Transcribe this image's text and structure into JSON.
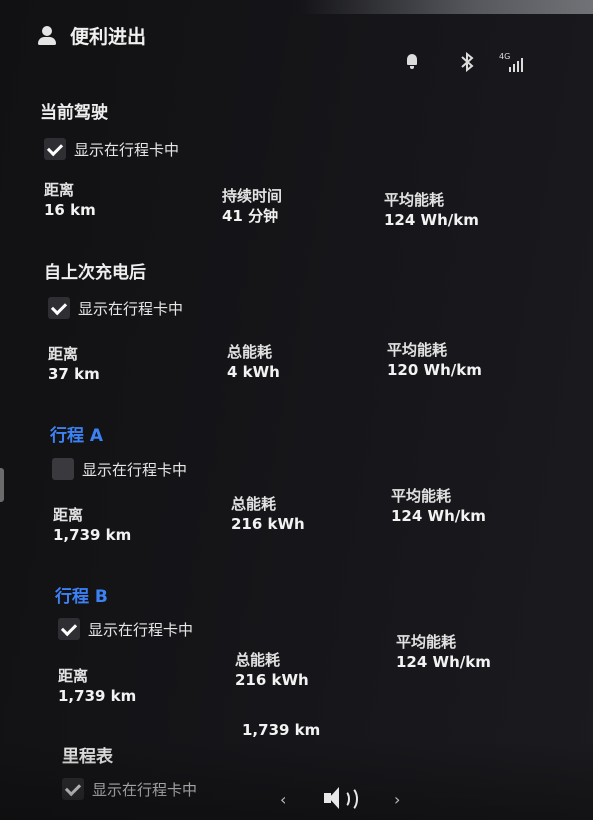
{
  "header": {
    "title": "便利进出",
    "icons": [
      "person-icon",
      "bell-icon",
      "bluetooth-icon",
      "lte-signal-icon"
    ],
    "lte_label": "4G"
  },
  "sections": [
    {
      "title": "当前驾驶",
      "checked": true,
      "checkbox_label": "显示在行程卡中",
      "stats": [
        {
          "label": "距离",
          "value": "16 km"
        },
        {
          "label": "持续时间",
          "value": "41 分钟"
        },
        {
          "label": "平均能耗",
          "value": "124 Wh/km"
        }
      ]
    },
    {
      "title": "自上次充电后",
      "checked": true,
      "checkbox_label": "显示在行程卡中",
      "stats": [
        {
          "label": "距离",
          "value": "37 km"
        },
        {
          "label": "总能耗",
          "value": "4 kWh"
        },
        {
          "label": "平均能耗",
          "value": "120 Wh/km"
        }
      ]
    },
    {
      "title": "行程 A",
      "checked": false,
      "checkbox_label": "显示在行程卡中",
      "stats": [
        {
          "label": "距离",
          "value": "1,739 km"
        },
        {
          "label": "总能耗",
          "value": "216 kWh"
        },
        {
          "label": "平均能耗",
          "value": "124 Wh/km"
        }
      ]
    },
    {
      "title": "行程 B",
      "checked": true,
      "checkbox_label": "显示在行程卡中",
      "stats": [
        {
          "label": "距离",
          "value": "1,739 km"
        },
        {
          "label": "总能耗",
          "value": "216 kWh"
        },
        {
          "label": "平均能耗",
          "value": "124 Wh/km"
        }
      ]
    }
  ],
  "odometer": {
    "title": "里程表",
    "value": "1,739 km",
    "checked": true,
    "checkbox_label": "显示在行程卡中"
  },
  "bottom_bar": {
    "prev": "‹",
    "next": "›",
    "icon": "volume-icon"
  },
  "colors": {
    "accent_blue": "#3d82f5",
    "background": "#141416",
    "text": "#e8e8e8"
  }
}
